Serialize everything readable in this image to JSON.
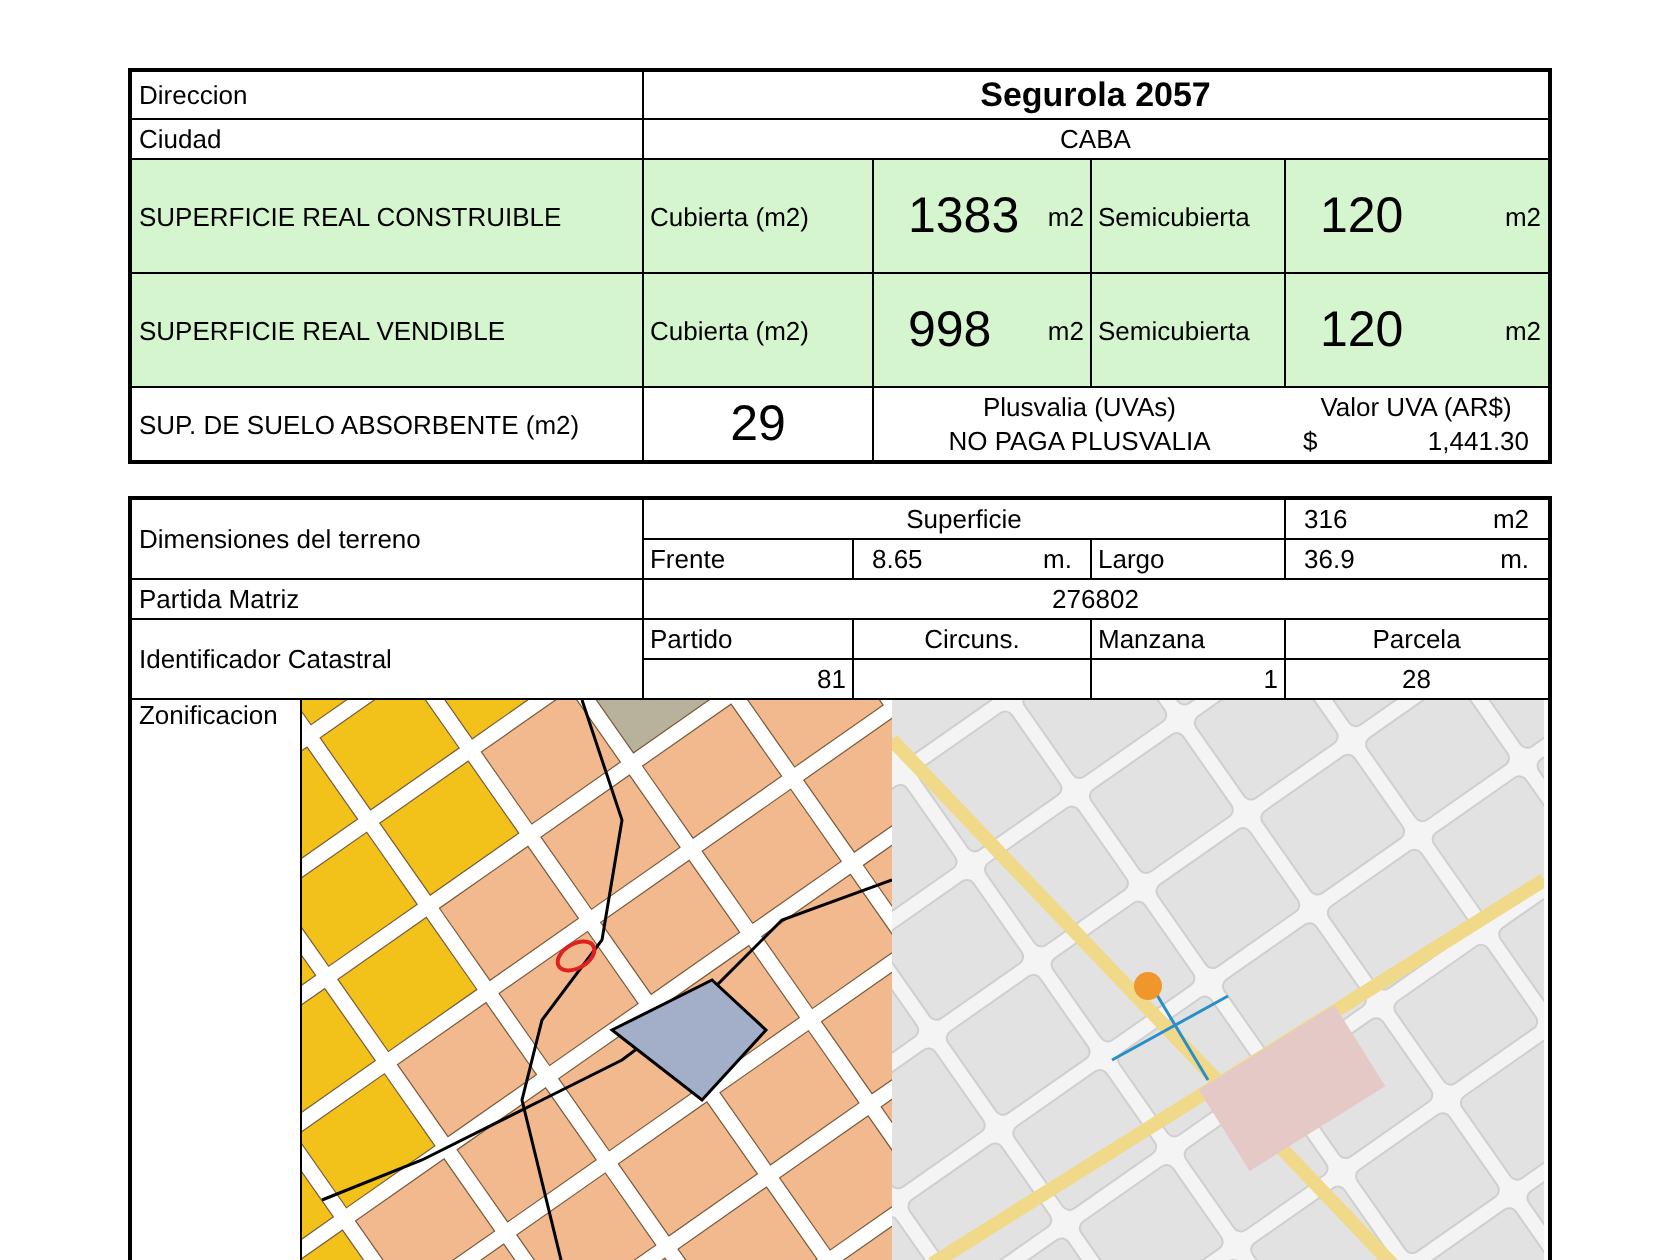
{
  "summary": {
    "address": {
      "label": "Direccion",
      "value": "Segurola 2057"
    },
    "city": {
      "label": "Ciudad",
      "value": "CABA"
    },
    "surfaces": [
      {
        "label": "SUPERFICIE REAL CONSTRUIBLE",
        "covered_label": "Cubierta (m2)",
        "covered_value": "1383",
        "covered_unit": "m2",
        "semi_label": "Semicubierta",
        "semi_value": "120",
        "semi_unit": "m2"
      },
      {
        "label": "SUPERFICIE REAL VENDIBLE",
        "covered_label": "Cubierta (m2)",
        "covered_value": "998",
        "covered_unit": "m2",
        "semi_label": "Semicubierta",
        "semi_value": "120",
        "semi_unit": "m2"
      }
    ],
    "absorbent": {
      "label": "SUP. DE SUELO ABSORBENTE (m2)",
      "value": "29"
    },
    "plusvalia": {
      "label": "Plusvalia (UVAs)",
      "value": "NO PAGA PLUSVALIA"
    },
    "uva": {
      "label": "Valor UVA (AR$)",
      "currency": "$",
      "value": "1,441.30"
    }
  },
  "parcel": {
    "dimensions": {
      "label": "Dimensiones del terreno",
      "area_label": "Superficie",
      "area_value": "316",
      "area_unit": "m2",
      "front_label": "Frente",
      "front_value": "8.65",
      "front_unit": "m.",
      "depth_label": "Largo",
      "depth_value": "36.9",
      "depth_unit": "m."
    },
    "partida": {
      "label": "Partida Matriz",
      "value": "276802"
    },
    "cadastral": {
      "label": "Identificador Catastral",
      "columns": [
        {
          "label": "Partido",
          "value": "81"
        },
        {
          "label": "Circuns."
        },
        {
          "label": "Manzana",
          "value": "1"
        },
        {
          "label": "Parcela",
          "value": "28"
        }
      ]
    }
  },
  "zoning": {
    "label": "Zonificacion"
  }
}
